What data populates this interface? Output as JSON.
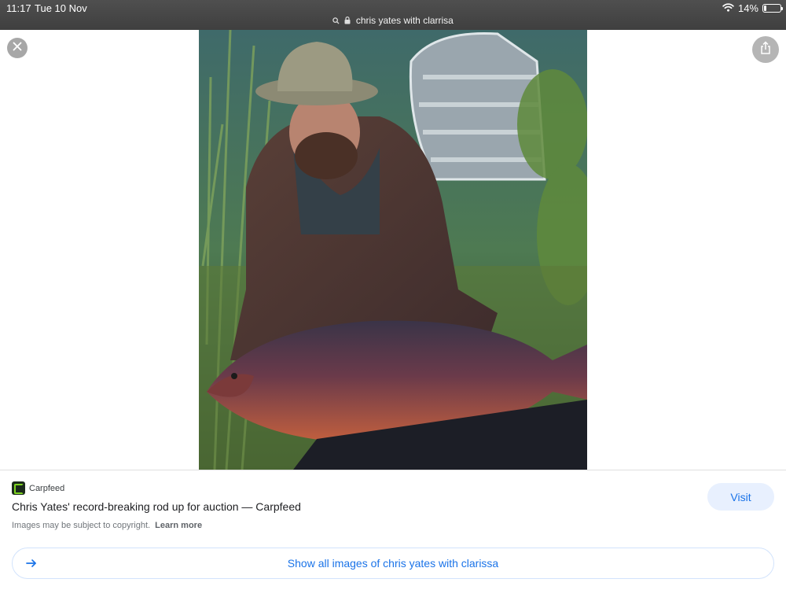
{
  "status_bar": {
    "time": "11:17",
    "date": "Tue 10 Nov",
    "battery": "14%",
    "battery_level": 0.14
  },
  "address_bar": {
    "url": "chris yates with clarrisa"
  },
  "viewer": {
    "close_icon": "close-icon",
    "share_icon": "share-icon"
  },
  "result": {
    "source_name": "Carpfeed",
    "title": "Chris Yates' record-breaking rod up for auction — Carpfeed",
    "copyright_note": "Images may be subject to copyright.",
    "learn_more": "Learn more",
    "visit_label": "Visit",
    "show_all_label": "Show all images of chris yates with clarissa"
  },
  "colors": {
    "accent": "#1a73e8",
    "visit_bg": "#e8f0fe",
    "topbar": "#454545"
  }
}
